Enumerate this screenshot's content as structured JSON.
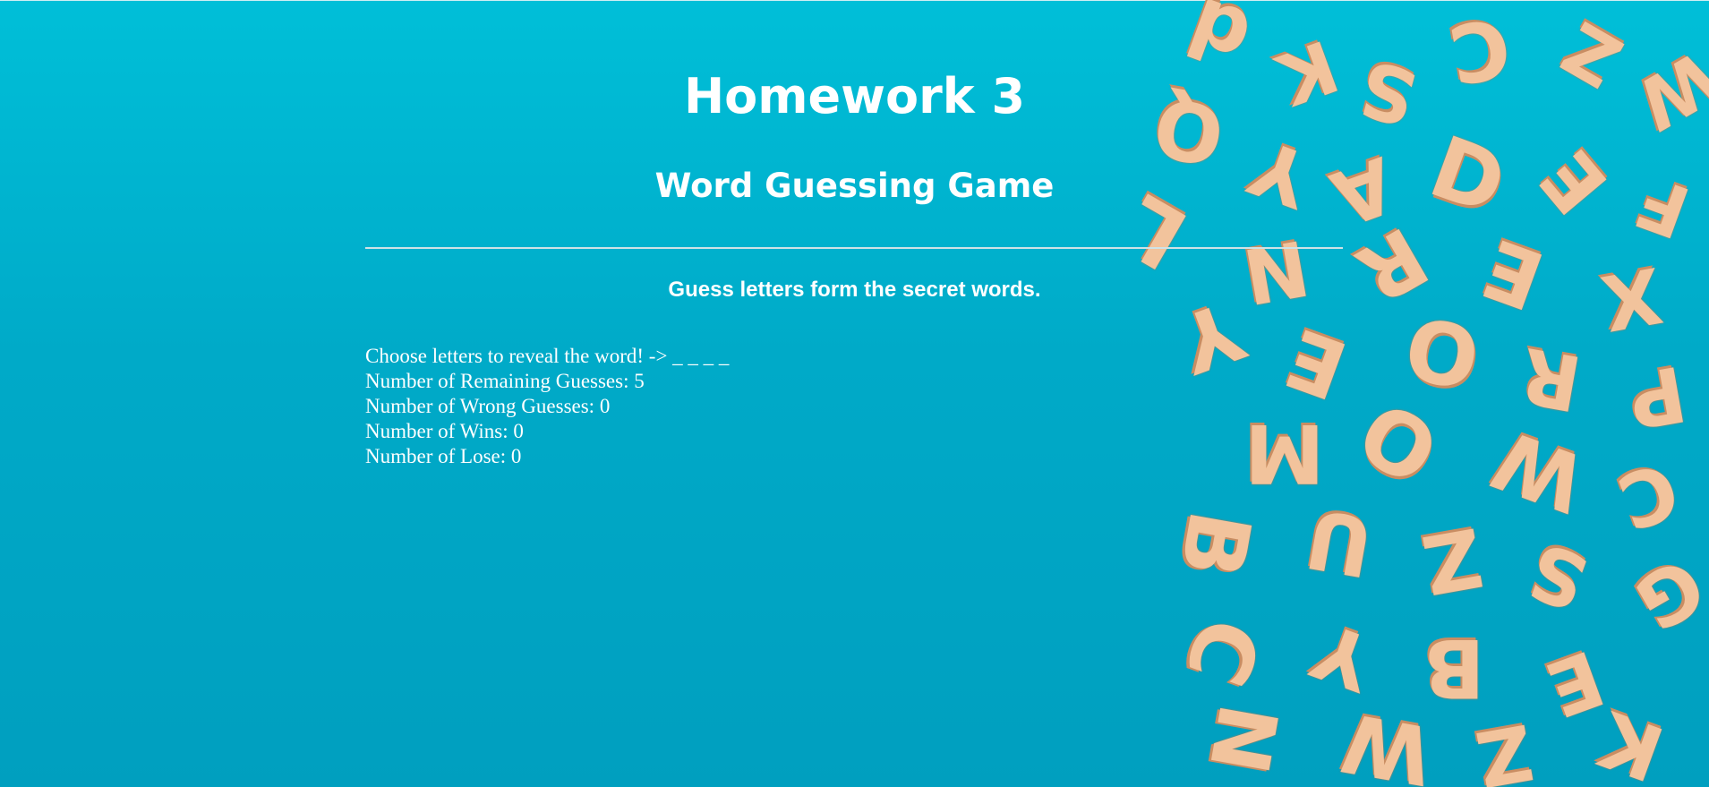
{
  "header": {
    "title": "Homework 3",
    "subtitle": "Word Guessing Game"
  },
  "instructions": "Guess letters form the secret words.",
  "stats": {
    "reveal_label": "Choose letters to reveal the word! -> ",
    "word_display": "_ _ _ _",
    "remaining_label": "Number of Remaining Guesses: ",
    "remaining_value": "5",
    "wrong_label": "Number of Wrong Guesses: ",
    "wrong_value": "0",
    "wins_label": "Number of Wins: ",
    "wins_value": "0",
    "lose_label": "Number of Lose: ",
    "lose_value": "0"
  },
  "colors": {
    "background": "#00aac8",
    "text": "#ffffff",
    "letter_tiles": "#f2c39c"
  }
}
